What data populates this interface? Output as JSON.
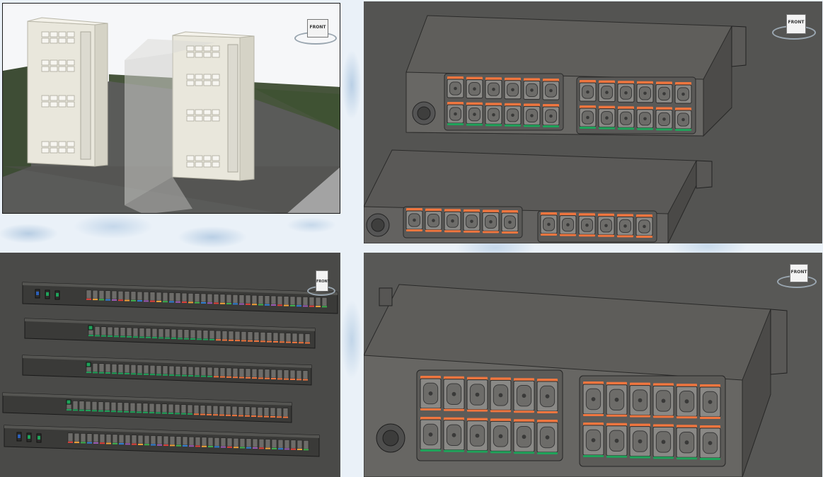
{
  "viewports": [
    {
      "id": "vp-tl",
      "name": "cabinets-view"
    },
    {
      "id": "vp-tr",
      "name": "pdu-pair-view"
    },
    {
      "id": "vp-bl",
      "name": "pdu-strips-view"
    },
    {
      "id": "vp-br",
      "name": "pdu-closeup-view"
    }
  ],
  "viewcube": {
    "face_label": "FRONT"
  },
  "colors": {
    "orange": "#f0763f",
    "green": "#1fa35a",
    "body": "#6a6966",
    "outlet": "#8a8986",
    "blue": "#2b5fb8"
  }
}
